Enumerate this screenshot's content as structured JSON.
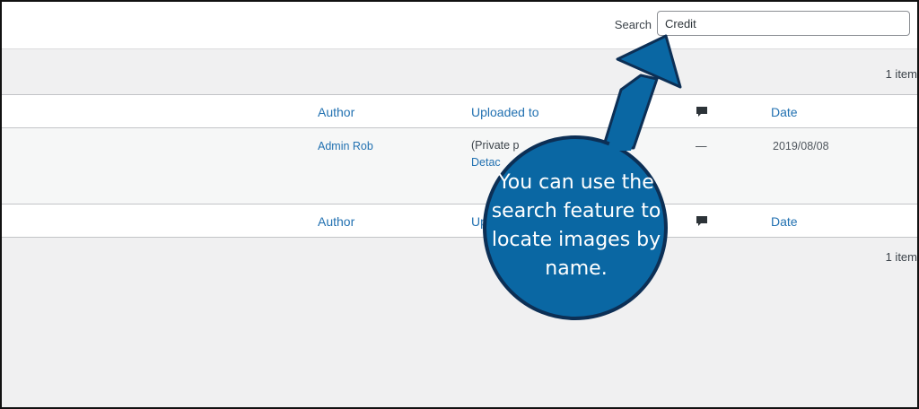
{
  "search": {
    "label": "Search",
    "value": "Credit"
  },
  "item_count": "1 item",
  "table": {
    "headers": {
      "author": "Author",
      "uploaded_to": "Uploaded to",
      "comments_icon": "comment-icon",
      "date": "Date"
    },
    "rows": [
      {
        "author": "Admin Rob",
        "uploaded_line1": "(Private p",
        "uploaded_line2": "Detac",
        "comments": "—",
        "date": "2019/08/08"
      }
    ]
  },
  "callout": {
    "text": "You can use the search feature to locate images by name.",
    "color": "#0a67a3",
    "border_color": "#0c2f55"
  },
  "colors": {
    "link": "#2271b1",
    "background": "#f0f0f1"
  }
}
